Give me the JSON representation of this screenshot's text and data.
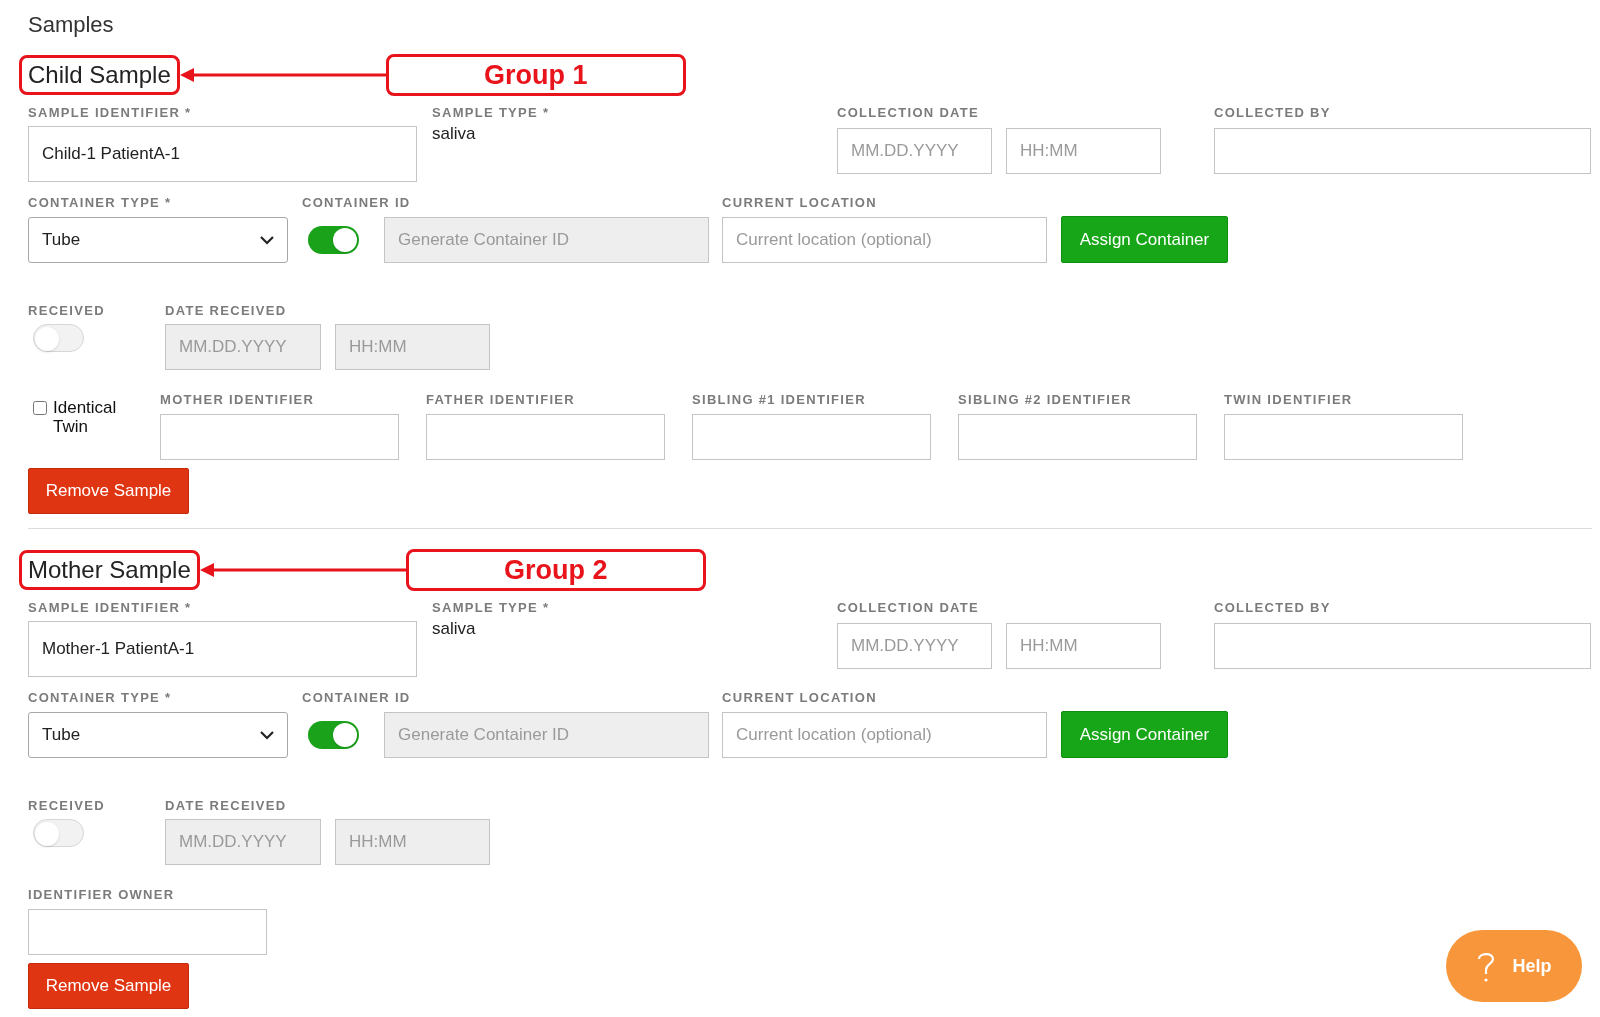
{
  "title": "Samples",
  "samples": [
    {
      "heading": "Child Sample",
      "annotation": "Group 1",
      "sample_identifier": {
        "label": "SAMPLE IDENTIFIER *",
        "value": "Child-1 PatientA-1"
      },
      "sample_type": {
        "label": "SAMPLE TYPE *",
        "value": "saliva"
      },
      "collection_date": {
        "label": "COLLECTION DATE",
        "date_placeholder": "MM.DD.YYYY",
        "time_placeholder": "HH:MM"
      },
      "collected_by": {
        "label": "COLLECTED BY"
      },
      "container_type": {
        "label": "CONTAINER TYPE *",
        "value": "Tube"
      },
      "container_id": {
        "label": "CONTAINER ID",
        "on": true,
        "placeholder": "Generate Container ID",
        "disabled": true
      },
      "current_location": {
        "label": "CURRENT LOCATION",
        "placeholder": "Current location (optional)"
      },
      "assign_button": "Assign Container",
      "received": {
        "label": "RECEIVED",
        "on": false
      },
      "date_received": {
        "label": "DATE RECEIVED",
        "date_placeholder": "MM.DD.YYYY",
        "time_placeholder": "HH:MM",
        "disabled": true
      },
      "extra_fields": [
        {
          "kind": "checkbox",
          "label": "Identical Twin",
          "checked": false
        },
        {
          "kind": "input",
          "label": "MOTHER IDENTIFIER"
        },
        {
          "kind": "input",
          "label": "FATHER IDENTIFIER"
        },
        {
          "kind": "input",
          "label": "SIBLING #1 IDENTIFIER"
        },
        {
          "kind": "input",
          "label": "SIBLING #2 IDENTIFIER"
        },
        {
          "kind": "input",
          "label": "TWIN IDENTIFIER"
        }
      ],
      "remove_button": "Remove Sample"
    },
    {
      "heading": "Mother Sample",
      "annotation": "Group 2",
      "sample_identifier": {
        "label": "SAMPLE IDENTIFIER *",
        "value": "Mother-1 PatientA-1"
      },
      "sample_type": {
        "label": "SAMPLE TYPE *",
        "value": "saliva"
      },
      "collection_date": {
        "label": "COLLECTION DATE",
        "date_placeholder": "MM.DD.YYYY",
        "time_placeholder": "HH:MM"
      },
      "collected_by": {
        "label": "COLLECTED BY"
      },
      "container_type": {
        "label": "CONTAINER TYPE *",
        "value": "Tube"
      },
      "container_id": {
        "label": "CONTAINER ID",
        "on": true,
        "placeholder": "Generate Container ID",
        "disabled": true
      },
      "current_location": {
        "label": "CURRENT LOCATION",
        "placeholder": "Current location (optional)"
      },
      "assign_button": "Assign Container",
      "received": {
        "label": "RECEIVED",
        "on": false
      },
      "date_received": {
        "label": "DATE RECEIVED",
        "date_placeholder": "MM.DD.YYYY",
        "time_placeholder": "HH:MM",
        "disabled": true
      },
      "extra_fields": [
        {
          "kind": "input",
          "label": "IDENTIFIER OWNER"
        }
      ],
      "remove_button": "Remove Sample"
    }
  ],
  "help_button": "Help"
}
